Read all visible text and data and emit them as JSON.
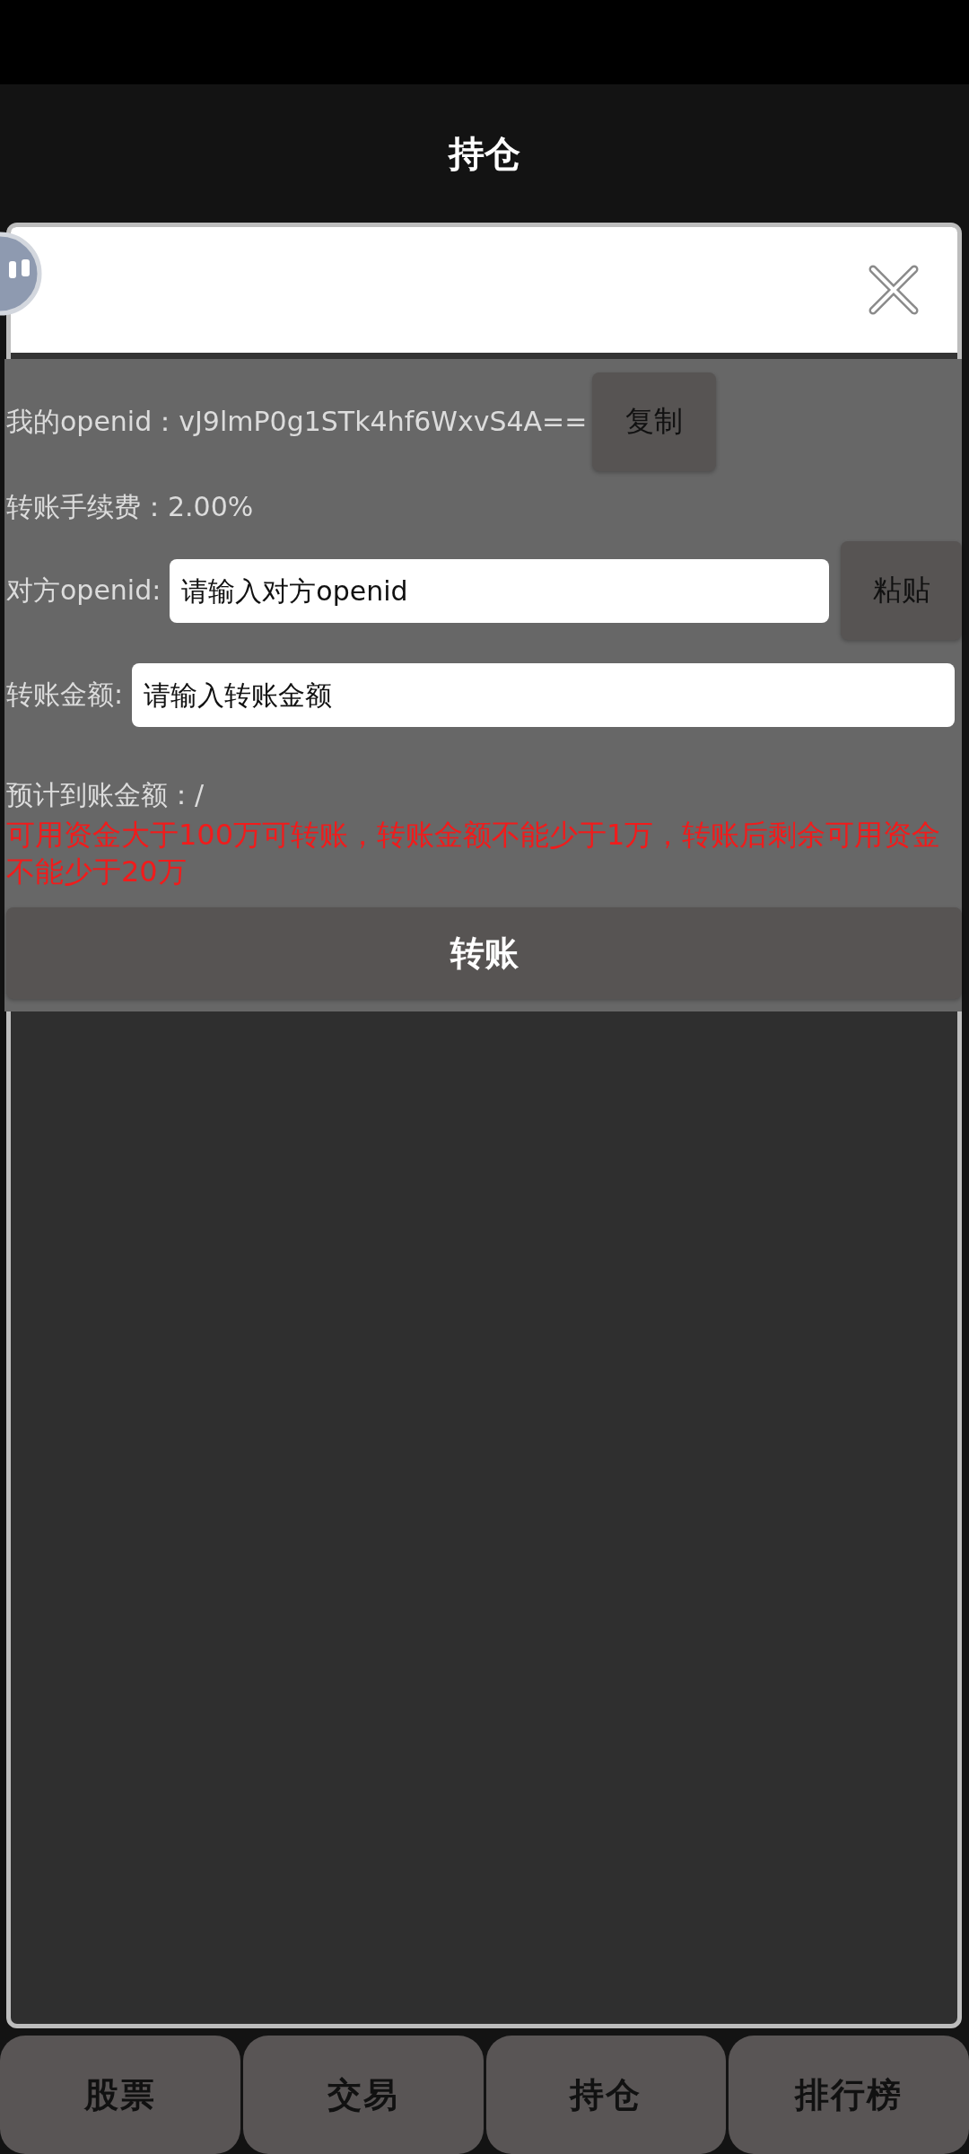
{
  "header": {
    "title": "持仓"
  },
  "dialog": {
    "openid_line": "我的openid：vJ9lmP0g1STk4hf6WxvS4A==",
    "copy_button": "复制",
    "fee_line": "转账手续费：2.00%",
    "fields": [
      {
        "label": "对方openid:",
        "placeholder": "请输入对方openid",
        "button": "粘贴"
      },
      {
        "label": "转账金额:",
        "placeholder": "请输入转账金额"
      }
    ],
    "estimate_line": "预计到账金额：/",
    "notice": "可用资金大于100万可转账，转账金额不能少于1万，转账后剩余可用资金不能少于20万",
    "submit_button": "转账"
  },
  "tab_bar": {
    "tabs": [
      "股票",
      "交易",
      "持仓",
      "排行榜"
    ]
  }
}
